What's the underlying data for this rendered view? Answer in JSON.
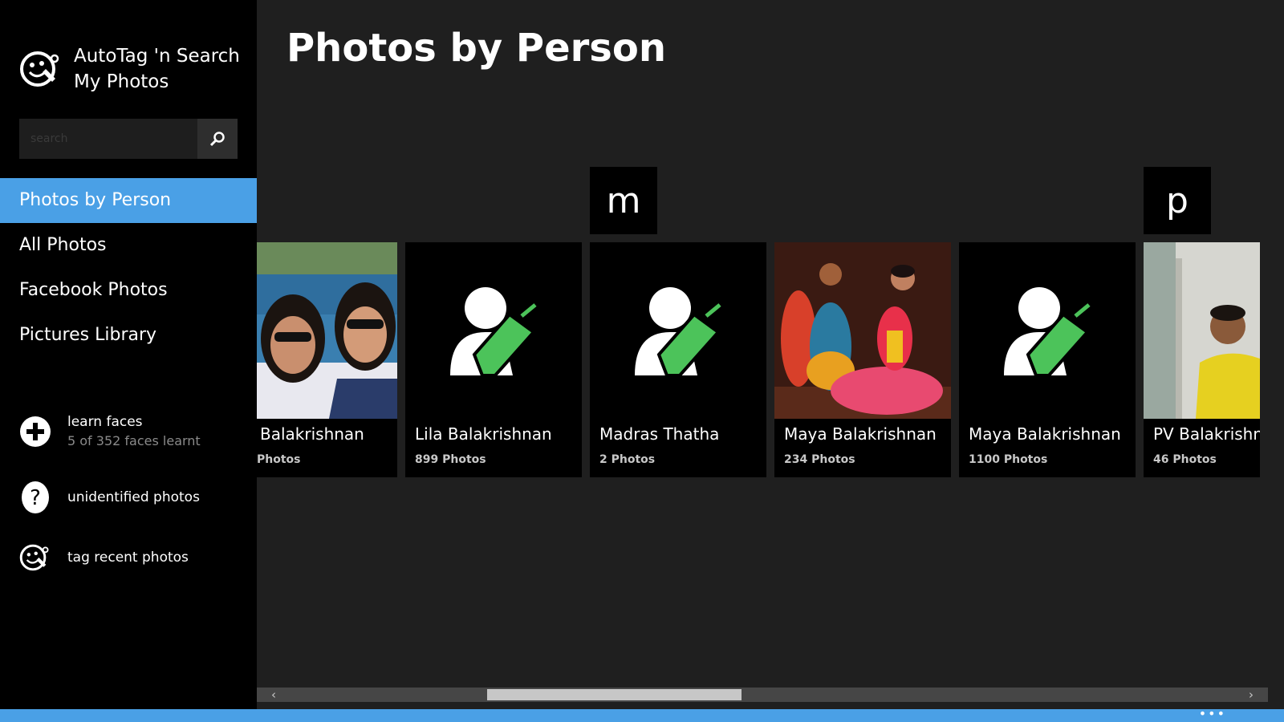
{
  "app": {
    "title_line1": "AutoTag 'n Search",
    "title_line2": "My Photos"
  },
  "search": {
    "placeholder": "search",
    "value": ""
  },
  "nav": {
    "items": [
      {
        "label": "Photos by Person",
        "active": true
      },
      {
        "label": "All Photos"
      },
      {
        "label": "Facebook Photos"
      },
      {
        "label": "Pictures Library"
      }
    ]
  },
  "actions": {
    "learn_faces": "learn faces",
    "learn_faces_status": "5 of 352 faces learnt",
    "unidentified_photos": "unidentified photos",
    "tag_recent_photos": "tag recent photos"
  },
  "main": {
    "page_title": "Photos by Person",
    "group_letters": [
      "m",
      "p"
    ],
    "people": [
      {
        "name": "Balakrishnan",
        "count": "Photos",
        "image": "photo"
      },
      {
        "name": "Lila Balakrishnan",
        "count": "899 Photos",
        "image": "placeholder-icon"
      },
      {
        "name": "Madras Thatha",
        "count": "2 Photos",
        "image": "placeholder-icon"
      },
      {
        "name": "Maya Balakrishnan",
        "count": "234 Photos",
        "image": "photo"
      },
      {
        "name": "Maya Balakrishnan",
        "count": "1100 Photos",
        "image": "placeholder-icon"
      },
      {
        "name": "PV Balakrishna",
        "count": "46 Photos",
        "image": "photo"
      }
    ]
  },
  "appbar": {
    "more_label": "•••"
  },
  "colors": {
    "accent": "#4aa0e6",
    "tag_green": "#4cc35a",
    "sidebar_bg": "#000000",
    "main_bg": "#1f1f1f"
  }
}
